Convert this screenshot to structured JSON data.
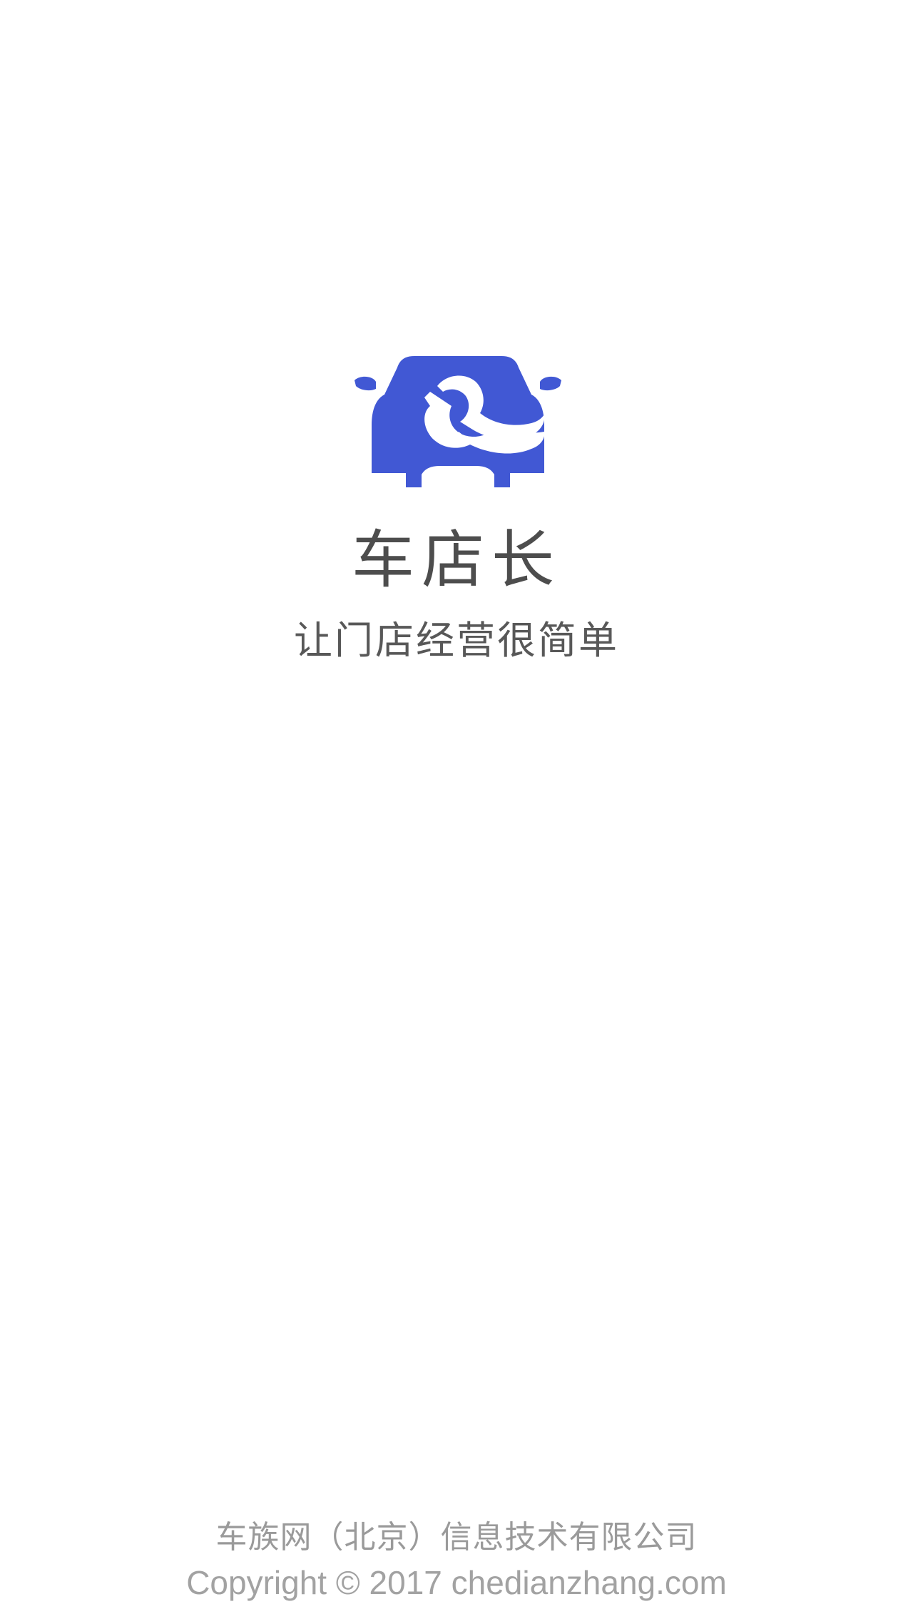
{
  "app": {
    "name": "车店长",
    "tagline": "让门店经营很简单",
    "logo_icon": "car-wrench-logo-icon",
    "brand_color": "#4158d4"
  },
  "footer": {
    "company": "车族网（北京）信息技术有限公司",
    "copyright": "Copyright © 2017 chedianzhang.com"
  }
}
